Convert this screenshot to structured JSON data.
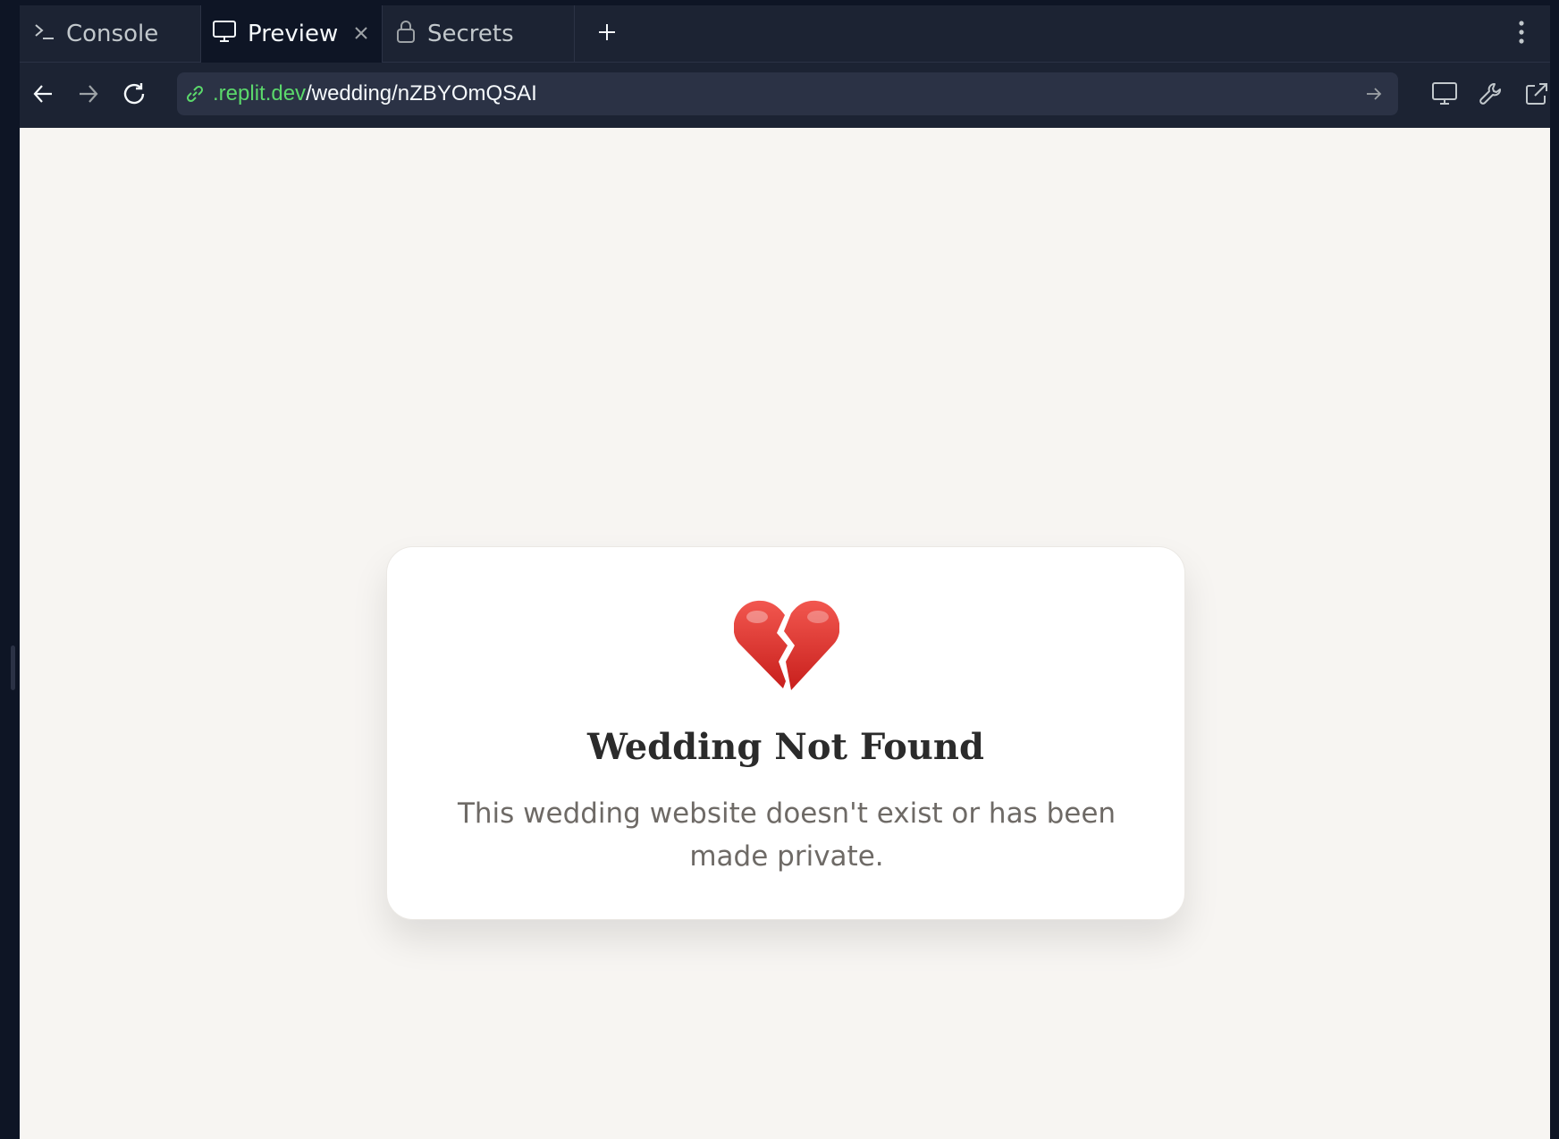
{
  "tabs": [
    {
      "label": "Console",
      "icon": "terminal-icon"
    },
    {
      "label": "Preview",
      "icon": "monitor-icon",
      "active": true
    },
    {
      "label": "Secrets",
      "icon": "lock-icon"
    }
  ],
  "address": {
    "domain": ".replit.dev",
    "path": "/wedding/nZBYOmQSAI"
  },
  "page": {
    "icon": "broken-heart-icon",
    "title": "Wedding Not Found",
    "message": "This wedding website doesn't exist or has been made private."
  },
  "colors": {
    "chrome_bg": "#1c2333",
    "active_tab_bg": "#0e1525",
    "url_bg": "#2b3245",
    "domain_green": "#5bd96b",
    "page_bg": "#f7f5f2",
    "heart_red": "#e0332f"
  }
}
